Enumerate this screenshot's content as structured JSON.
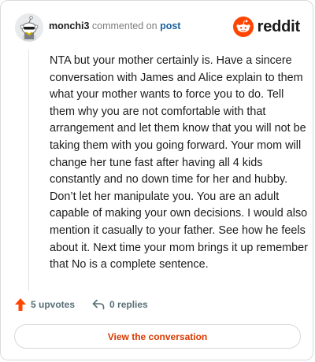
{
  "header": {
    "username": "monchi3",
    "action_text": "commented on",
    "post_link": "post",
    "brand": "reddit",
    "avatar_icon": "snoo-avatar-icon",
    "brand_icon": "reddit-logo-icon"
  },
  "comment": {
    "text": "NTA but your mother certainly is. Have a sincere conversation with James and Alice explain to them what your mother wants to force you to do. Tell them why you are not comfortable with that arrangement and let them know that you will not be taking them with you going forward. Your mom will change her tune fast after having all 4 kids constantly and no down time for her and hubby. Don’t let her manipulate you. You are an adult capable of making your own decisions. I would also mention it casually to your father. See how he feels about it. Next time your mom brings it up remember that No is a complete sentence."
  },
  "actions": {
    "upvotes": "5 upvotes",
    "replies": "0 replies",
    "upvote_icon": "upvote-arrow-icon",
    "reply_icon": "reply-arrow-icon"
  },
  "cta": {
    "label": "View the conversation"
  },
  "colors": {
    "accent": "#ff4500",
    "cta_text": "#d93900",
    "link": "#1a5f9e"
  }
}
